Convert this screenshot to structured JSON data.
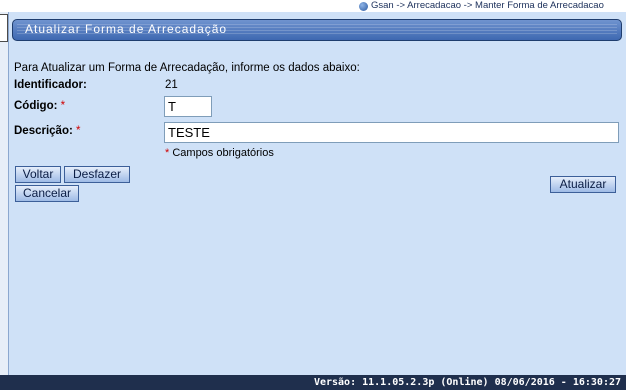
{
  "breadcrumb": "Gsan -> Arrecadacao -> Manter Forma de Arrecadacao",
  "page_title": "Atualizar Forma de Arrecadação",
  "intro": "Para Atualizar um Forma de Arrecadação, informe os dados abaixo:",
  "form": {
    "identificador_label": "Identificador:",
    "identificador_value": "21",
    "codigo_label": "Código:",
    "codigo_value": "T",
    "descricao_label": "Descrição:",
    "descricao_value": "TESTE",
    "required_mark": "*",
    "required_note": "Campos obrigatórios"
  },
  "buttons": {
    "voltar": "Voltar",
    "desfazer": "Desfazer",
    "cancelar": "Cancelar",
    "atualizar": "Atualizar"
  },
  "footer": "Versão: 11.1.05.2.3p (Online) 08/06/2016 - 16:30:27"
}
